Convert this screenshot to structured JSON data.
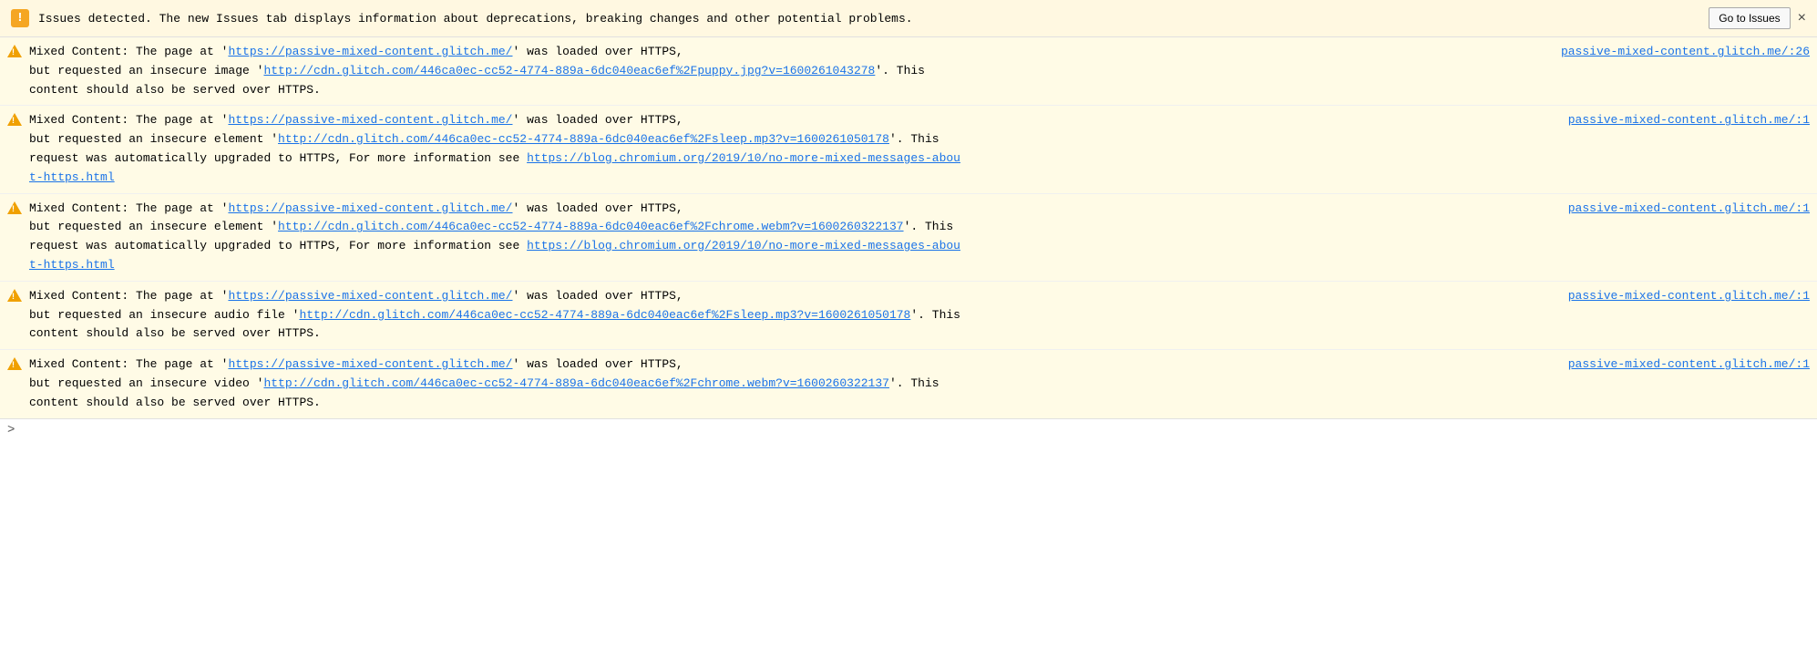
{
  "banner": {
    "icon": "!",
    "text": "Issues detected. The new Issues tab displays information about deprecations, breaking changes and other potential problems.",
    "go_to_issues_label": "Go to Issues",
    "close_label": "×"
  },
  "messages": [
    {
      "id": 1,
      "source_link": "passive-mixed-content.glitch.me/:26",
      "source_url": "https://passive-mixed-content.glitch.me/:26",
      "lines": [
        {
          "text_before": "Mixed Content: The page at '",
          "page_url": "https://passive-mixed-content.glitch.me/",
          "text_mid": "' was loaded over HTTPS, ",
          "text_after": ""
        },
        {
          "text_before": "but requested an insecure image '",
          "resource_url": "http://cdn.glitch.com/446ca0ec-cc52-4774-889a-6dc040eac6ef%2Fpuppy.jpg?v=1600261043278",
          "text_after": "'. This"
        },
        {
          "plain": "content should also be served over HTTPS."
        }
      ]
    },
    {
      "id": 2,
      "source_link": "passive-mixed-content.glitch.me/:1",
      "source_url": "https://passive-mixed-content.glitch.me/:1",
      "lines": [
        {
          "text_before": "Mixed Content: The page at '",
          "page_url": "https://passive-mixed-content.glitch.me/",
          "text_mid": "' was loaded over HTTPS, ",
          "text_after": ""
        },
        {
          "text_before": "but requested an insecure element '",
          "resource_url": "http://cdn.glitch.com/446ca0ec-cc52-4774-889a-6dc040eac6ef%2Fsleep.mp3?v=1600261050178",
          "text_after": "'. This"
        },
        {
          "text_before": "request was automatically upgraded to HTTPS, For more information see ",
          "blog_url": "https://blog.chromium.org/2019/10/no-more-mixed-messages-abou",
          "blog_url2": "t-https.html",
          "plain": ""
        }
      ]
    },
    {
      "id": 3,
      "source_link": "passive-mixed-content.glitch.me/:1",
      "source_url": "https://passive-mixed-content.glitch.me/:1",
      "lines": [
        {
          "text_before": "Mixed Content: The page at '",
          "page_url": "https://passive-mixed-content.glitch.me/",
          "text_mid": "' was loaded over HTTPS, ",
          "text_after": ""
        },
        {
          "text_before": "but requested an insecure element '",
          "resource_url": "http://cdn.glitch.com/446ca0ec-cc52-4774-889a-6dc040eac6ef%2Fchrome.webm?v=1600260322137",
          "text_after": "'. This"
        },
        {
          "text_before": "request was automatically upgraded to HTTPS, For more information see ",
          "blog_url": "https://blog.chromium.org/2019/10/no-more-mixed-messages-abou",
          "blog_url2": "t-https.html",
          "plain": ""
        }
      ]
    },
    {
      "id": 4,
      "source_link": "passive-mixed-content.glitch.me/:1",
      "source_url": "https://passive-mixed-content.glitch.me/:1",
      "lines": [
        {
          "text_before": "Mixed Content: The page at '",
          "page_url": "https://passive-mixed-content.glitch.me/",
          "text_mid": "' was loaded over HTTPS, ",
          "text_after": ""
        },
        {
          "text_before": "but requested an insecure audio file '",
          "resource_url": "http://cdn.glitch.com/446ca0ec-cc52-4774-889a-6dc040eac6ef%2Fsleep.mp3?v=1600261050178",
          "text_after": "'. This"
        },
        {
          "plain": "content should also be served over HTTPS."
        }
      ]
    },
    {
      "id": 5,
      "source_link": "passive-mixed-content.glitch.me/:1",
      "source_url": "https://passive-mixed-content.glitch.me/:1",
      "lines": [
        {
          "text_before": "Mixed Content: The page at '",
          "page_url": "https://passive-mixed-content.glitch.me/",
          "text_mid": "' was loaded over HTTPS, ",
          "text_after": ""
        },
        {
          "text_before": "but requested an insecure video '",
          "resource_url": "http://cdn.glitch.com/446ca0ec-cc52-4774-889a-6dc040eac6ef%2Fchrome.webm?v=1600260322137",
          "text_after": "'. This"
        },
        {
          "plain": "content should also be served over HTTPS."
        }
      ]
    }
  ],
  "bottom": {
    "chevron": ">"
  }
}
